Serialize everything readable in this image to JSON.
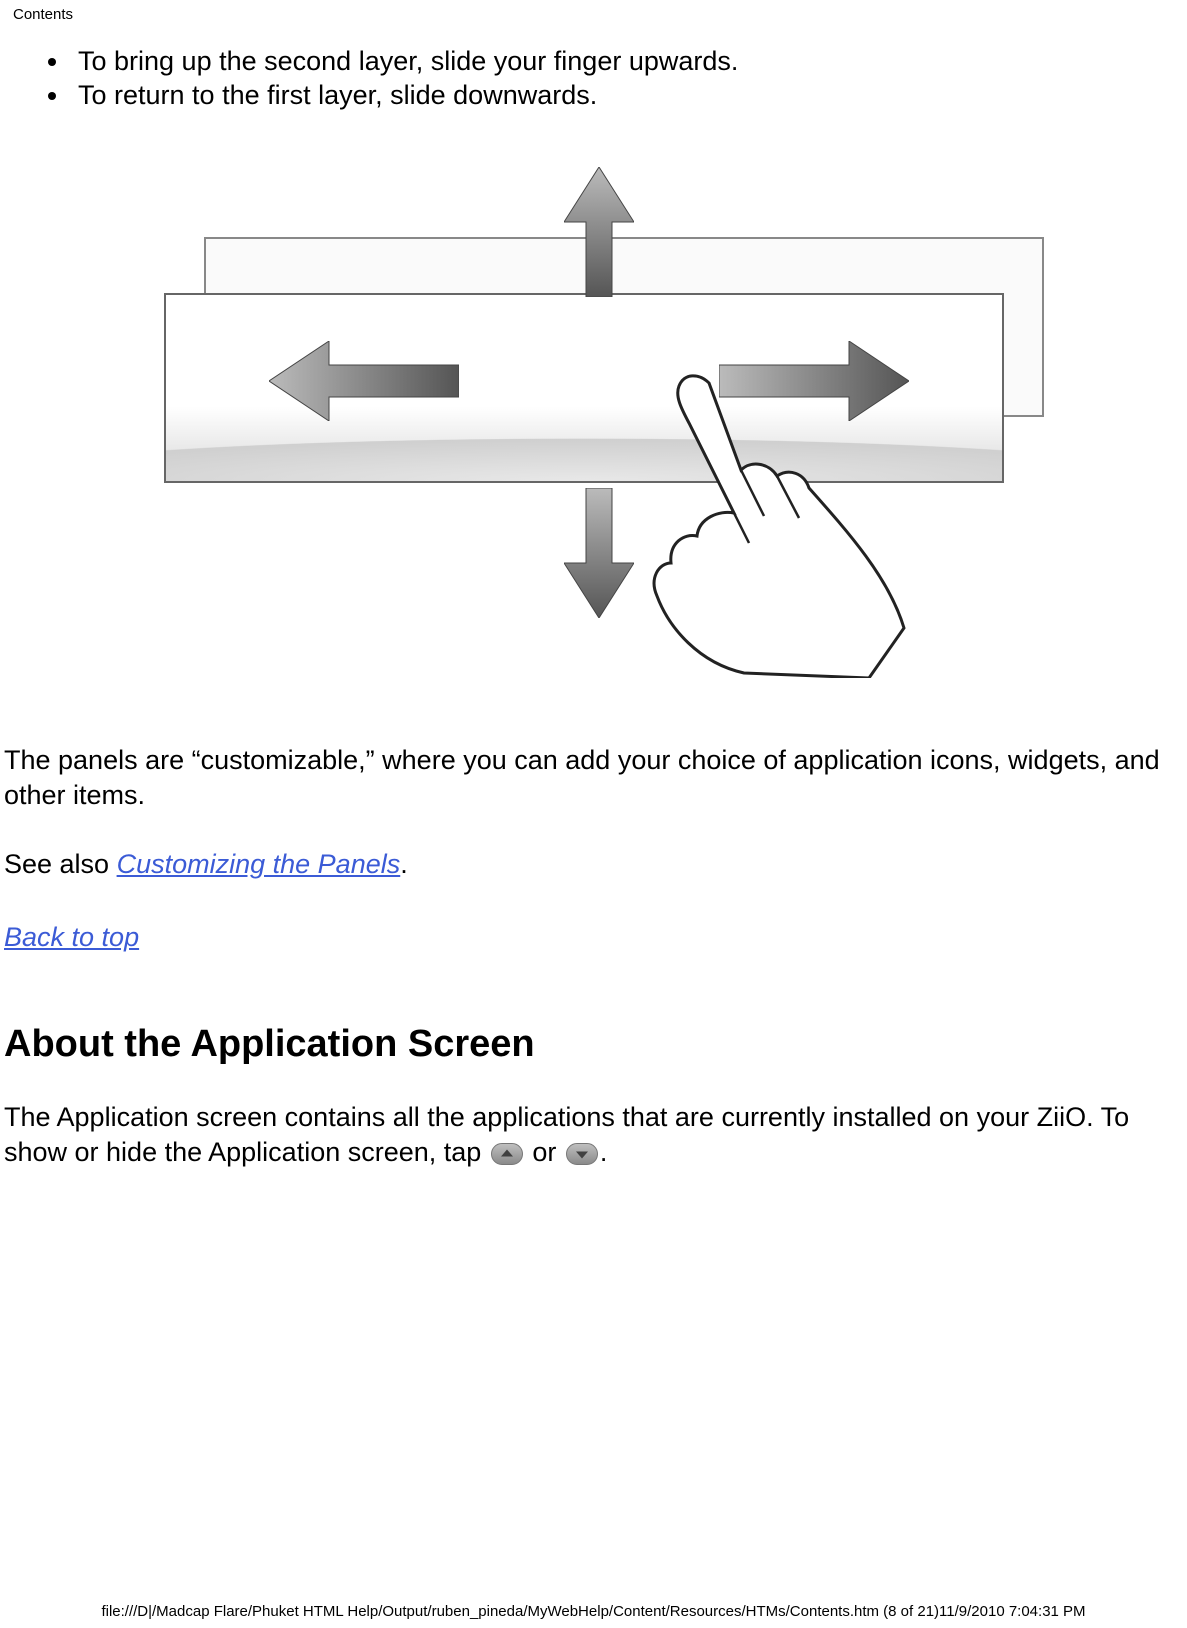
{
  "header": {
    "title": "Contents"
  },
  "bullets": [
    "To bring up the second layer, slide your finger upwards.",
    "To return to the first layer, slide downwards."
  ],
  "paragraphs": {
    "panels_customizable": "The panels are “customizable,” where you can add your choice of application icons, widgets, and other items.",
    "see_also_prefix": "See also ",
    "see_also_link": "Customizing the Panels",
    "see_also_suffix": ".",
    "back_to_top": "Back to top",
    "about_heading": "About the Application Screen",
    "app_screen_1": "The Application screen contains all the applications that are currently installed on your ZiiO. To show or hide the Application screen, tap ",
    "or_word": " or ",
    "period": "."
  },
  "footer": "file:///D|/Madcap Flare/Phuket HTML Help/Output/ruben_pineda/MyWebHelp/Content/Resources/HTMs/Contents.htm (8 of 21)11/9/2010 7:04:31 PM"
}
